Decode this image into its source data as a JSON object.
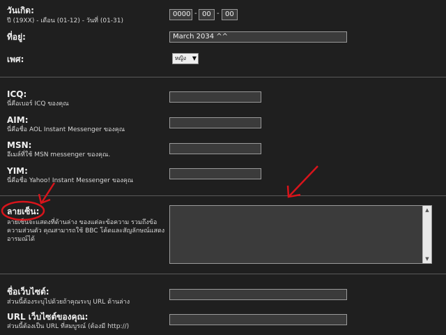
{
  "birthday": {
    "label": "วันเกิด:",
    "sub": "ปี (19XX) - เดือน (01-12) - วันที่ (01-31)",
    "year": "0000",
    "month": "00",
    "day": "00",
    "dash1": "-",
    "dash2": "-"
  },
  "location": {
    "label": "ที่อยู่:",
    "value": "March 2034 ^^"
  },
  "gender": {
    "label": "เพศ:",
    "selected": "หญิง"
  },
  "icq": {
    "label": "ICQ:",
    "sub": "นี่คือเบอร์ ICQ ของคุณ",
    "value": ""
  },
  "aim": {
    "label": "AIM:",
    "sub": "นี่คือชื่อ AOL Instant Messenger ของคุณ",
    "value": ""
  },
  "msn": {
    "label": "MSN:",
    "sub": "อีเมล์ที่ใช้ MSN messenger ของคุณ.",
    "value": ""
  },
  "yim": {
    "label": "YIM:",
    "sub": "นี่คือชื่อ Yahoo! Instant Messenger ของคุณ",
    "value": ""
  },
  "signature": {
    "label": "ลายเซ็น:",
    "sub1": "ลายเซ็นจะแสดงที่ด้านล่าง ของแต่ละข้อความ รวมถึงข้อ",
    "sub2": "ความส่วนตัว คุณสามารถใช้ BBC โค้ดและสัญลักษณ์แสดง",
    "sub3": "อารมณ์ได้",
    "value": ""
  },
  "website_title": {
    "label": "ชื่อเว็บไซต์:",
    "sub": "ส่วนนี้ต้องระบุไปด้วยถ้าคุณระบุ URL ด้านล่าง",
    "value": ""
  },
  "website_url": {
    "label": "URL เว็บไซต์ของคุณ:",
    "sub": "ส่วนนี้ต้องเป็น URL ที่สมบูรณ์ (ต้องมี http://)",
    "value": ""
  },
  "colors": {
    "annotation": "#d8141b",
    "field_bg": "#3b3b3b",
    "page_bg": "#1f1f1f"
  }
}
